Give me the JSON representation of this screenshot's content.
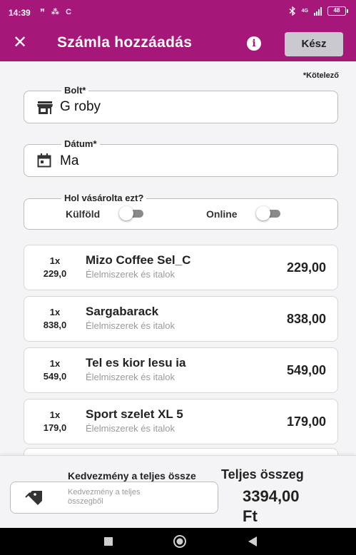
{
  "status_bar": {
    "time": "14:39",
    "left_icons_text": "ꟸ ⁂ C",
    "network_label": "4G",
    "battery": "48"
  },
  "app_bar": {
    "close_icon": "close-icon",
    "title": "Számla hozzáadás",
    "info_label": "i",
    "done_label": "Kész",
    "background_color": "#a6177a"
  },
  "required_note": "*Kötelező",
  "store_field": {
    "label": "Bolt*",
    "value": "G roby",
    "icon": "store-icon"
  },
  "date_field": {
    "label": "Dátum*",
    "value": "Ma",
    "icon": "calendar-icon"
  },
  "purchase_location": {
    "legend": "Hol vásárolta ezt?",
    "abroad_label": "Külföld",
    "abroad_on": false,
    "online_label": "Online",
    "online_on": false
  },
  "items": [
    {
      "qty": "1x",
      "unit_price": "229,0",
      "name": "Mizo Coffee Sel_C",
      "category": "Élelmiszerek és italok",
      "price": "229,00"
    },
    {
      "qty": "1x",
      "unit_price": "838,0",
      "name": "Sargabarack",
      "category": "Élelmiszerek és italok",
      "price": "838,00"
    },
    {
      "qty": "1x",
      "unit_price": "549,0",
      "name": "Tel es kior lesu ia",
      "category": "Élelmiszerek és italok",
      "price": "549,00"
    },
    {
      "qty": "1x",
      "unit_price": "179,0",
      "name": "Sport szelet XL 5",
      "category": "Élelmiszerek és italok",
      "price": "179,00"
    }
  ],
  "footer": {
    "discount_label": "Kedvezmény a teljes össze",
    "discount_placeholder": "Kedvezmény a teljes összegből",
    "discount_icon": "tag-icon",
    "total_label": "Teljes összeg",
    "total_amount": "3394,00",
    "total_currency": "Ft"
  },
  "nav_bar": {
    "recents_icon": "recents-icon",
    "home_icon": "home-icon",
    "back_icon": "back-icon"
  }
}
